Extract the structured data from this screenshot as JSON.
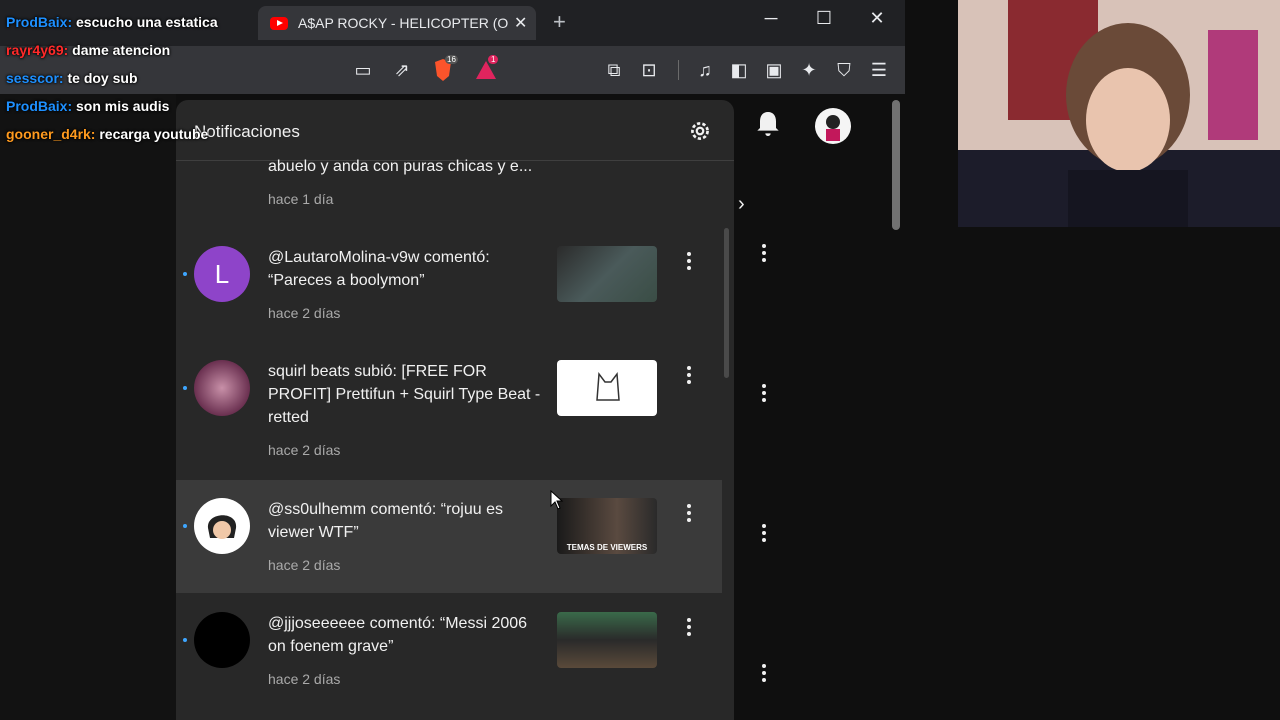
{
  "browser": {
    "active_tab_title": "A$AP ROCKY - HELICOPTER (Offi",
    "brave_badge": "16",
    "rewards_badge": "1"
  },
  "chat": [
    {
      "user": "ProdBaix:",
      "message": "escucho una estatica",
      "color": "#1e90ff"
    },
    {
      "user": "rayr4y69:",
      "message": "dame atencion",
      "color": "#ff2a2a"
    },
    {
      "user": "sesscor:",
      "message": "te doy sub",
      "color": "#1e90ff"
    },
    {
      "user": "ProdBaix:",
      "message": "son mis audis",
      "color": "#1e90ff"
    },
    {
      "user": "gooner_d4rk:",
      "message": "recarga youtube",
      "color": "#ff9a1e"
    }
  ],
  "panel": {
    "title": "Notificaciones",
    "notifications": [
      {
        "text": "abuelo y anda con puras chicas y e...",
        "time": "hace 1 día"
      },
      {
        "text": "@LautaroMolina-v9w comentó: “Pareces a boolymon”",
        "time": "hace 2 días",
        "avatar_letter": "L"
      },
      {
        "text": "squirl beats subió: [FREE FOR PROFIT] Prettifun + Squirl Type Beat - retted",
        "time": "hace 2 días"
      },
      {
        "text": "@ss0ulhemm comentó: “rojuu es viewer WTF”",
        "time": "hace 2 días",
        "thumb_caption": "TEMAS DE VIEWERS"
      },
      {
        "text": "@jjjoseeeeee comentó: “Messi 2006 on foenem grave”",
        "time": "hace 2 días"
      }
    ]
  },
  "colors": {
    "accent_blue": "#3ea6ff",
    "panel_bg": "#282828",
    "avatar_purple": "#8e44c9"
  }
}
